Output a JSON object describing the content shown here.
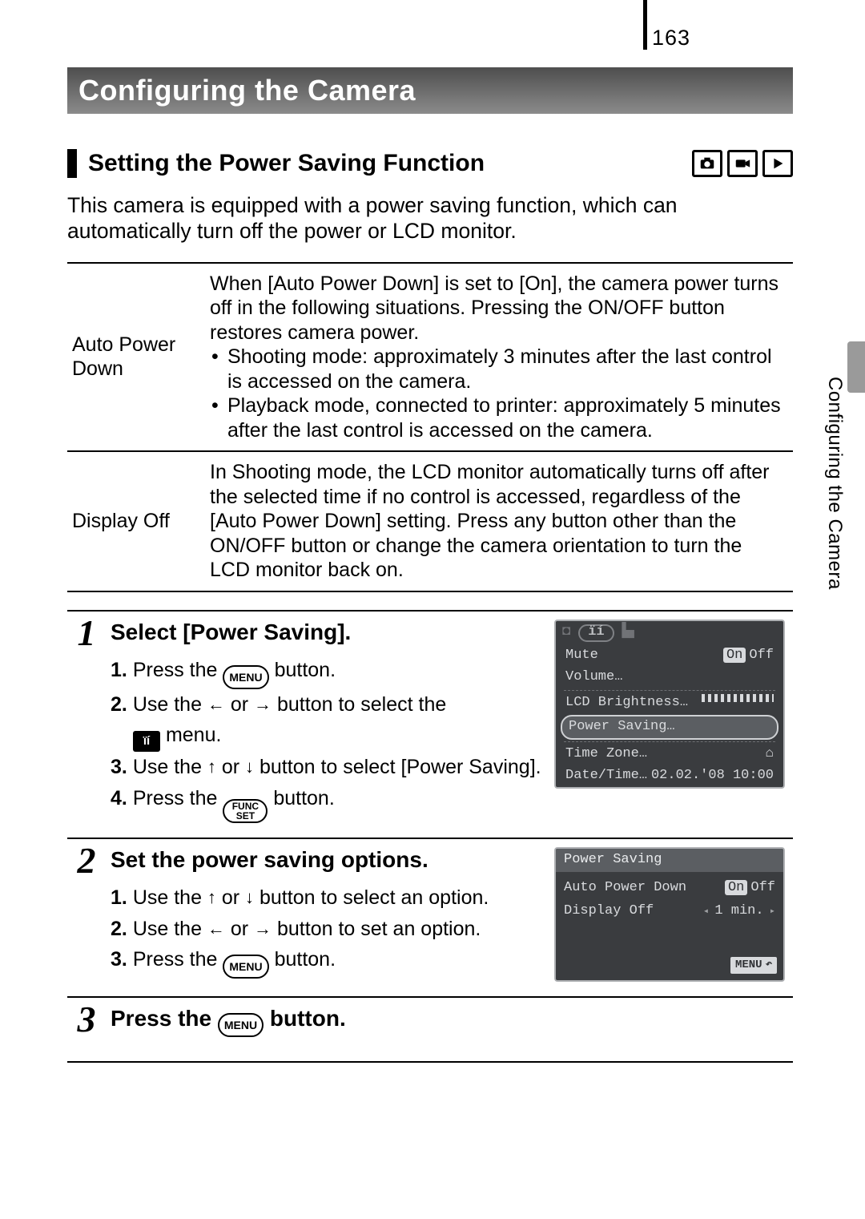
{
  "page_number": "163",
  "title": "Configuring the Camera",
  "side_tab": "Configuring the Camera",
  "section": {
    "title": "Setting the Power Saving Function",
    "mode_icons": [
      "camera-icon",
      "movie-icon",
      "playback-icon"
    ]
  },
  "intro": "This camera is equipped with a power saving function, which can automatically turn off the power or LCD monitor.",
  "feature_table": [
    {
      "key": "Auto Power Down",
      "lead": "When [Auto Power Down] is set to [On], the camera power turns off in the following situations. Pressing the ON/OFF button restores camera power.",
      "bullets": [
        "Shooting mode: approximately 3 minutes after the last control is accessed on the camera.",
        "Playback mode, connected to printer: approximately 5 minutes after the last control is accessed on the camera."
      ]
    },
    {
      "key": "Display Off",
      "lead": "In Shooting mode, the LCD monitor automatically turns off after the selected time if no control is accessed, regardless of the [Auto Power Down] setting. Press any button other than the ON/OFF button or change the camera orientation to turn the LCD monitor back on.",
      "bullets": []
    }
  ],
  "buttons": {
    "menu": "MENU",
    "func_top": "FUNC",
    "func_bot": "SET"
  },
  "tools_menu_glyph": "ïí",
  "steps": [
    {
      "num": "1",
      "head": "Select [Power Saving].",
      "items": [
        {
          "n": "1.",
          "pre": "Press the ",
          "badge": "menu",
          "post": " button."
        },
        {
          "n": "2.",
          "text_a": "Use the ",
          "arrows": [
            "←",
            "→"
          ],
          "text_b": " button to select the ",
          "chip": true,
          "text_c": " menu."
        },
        {
          "n": "3.",
          "text_a": "Use the ",
          "arrows": [
            "↑",
            "↓"
          ],
          "text_b": " button to select [Power Saving]."
        },
        {
          "n": "4.",
          "pre": "Press the ",
          "badge": "func",
          "post": " button."
        }
      ],
      "screen": {
        "type": "setup",
        "tabs_active": "tools",
        "rows": [
          {
            "l": "Mute",
            "r_on": "On",
            "r_off": "Off"
          },
          {
            "l": "Volume…",
            "r": ""
          },
          {
            "l": "LCD Brightness…",
            "r_bar": true
          },
          {
            "l": "Power Saving…",
            "selected": true
          },
          {
            "l": "Time Zone…",
            "r_icon": "home"
          },
          {
            "l": "Date/Time…",
            "r": "02.02.'08 10:00"
          }
        ]
      }
    },
    {
      "num": "2",
      "head": "Set the power saving options.",
      "items": [
        {
          "n": "1.",
          "text_a": "Use the ",
          "arrows": [
            "↑",
            "↓"
          ],
          "text_b": " button to select an option."
        },
        {
          "n": "2.",
          "text_a": "Use the ",
          "arrows": [
            "←",
            "→"
          ],
          "text_b": " button to set an option."
        },
        {
          "n": "3.",
          "pre": "Press the ",
          "badge": "menu",
          "post": " button."
        }
      ],
      "screen": {
        "type": "power",
        "title": "Power Saving",
        "rows": [
          {
            "l": "Auto Power Down",
            "r_on": "On",
            "r_off": "Off"
          },
          {
            "l": "Display Off",
            "r_arrows": true,
            "r": "1 min."
          }
        ],
        "foot": "MENU"
      }
    },
    {
      "num": "3",
      "head_pre": "Press the ",
      "head_badge": "menu",
      "head_post": " button.",
      "items": []
    }
  ]
}
